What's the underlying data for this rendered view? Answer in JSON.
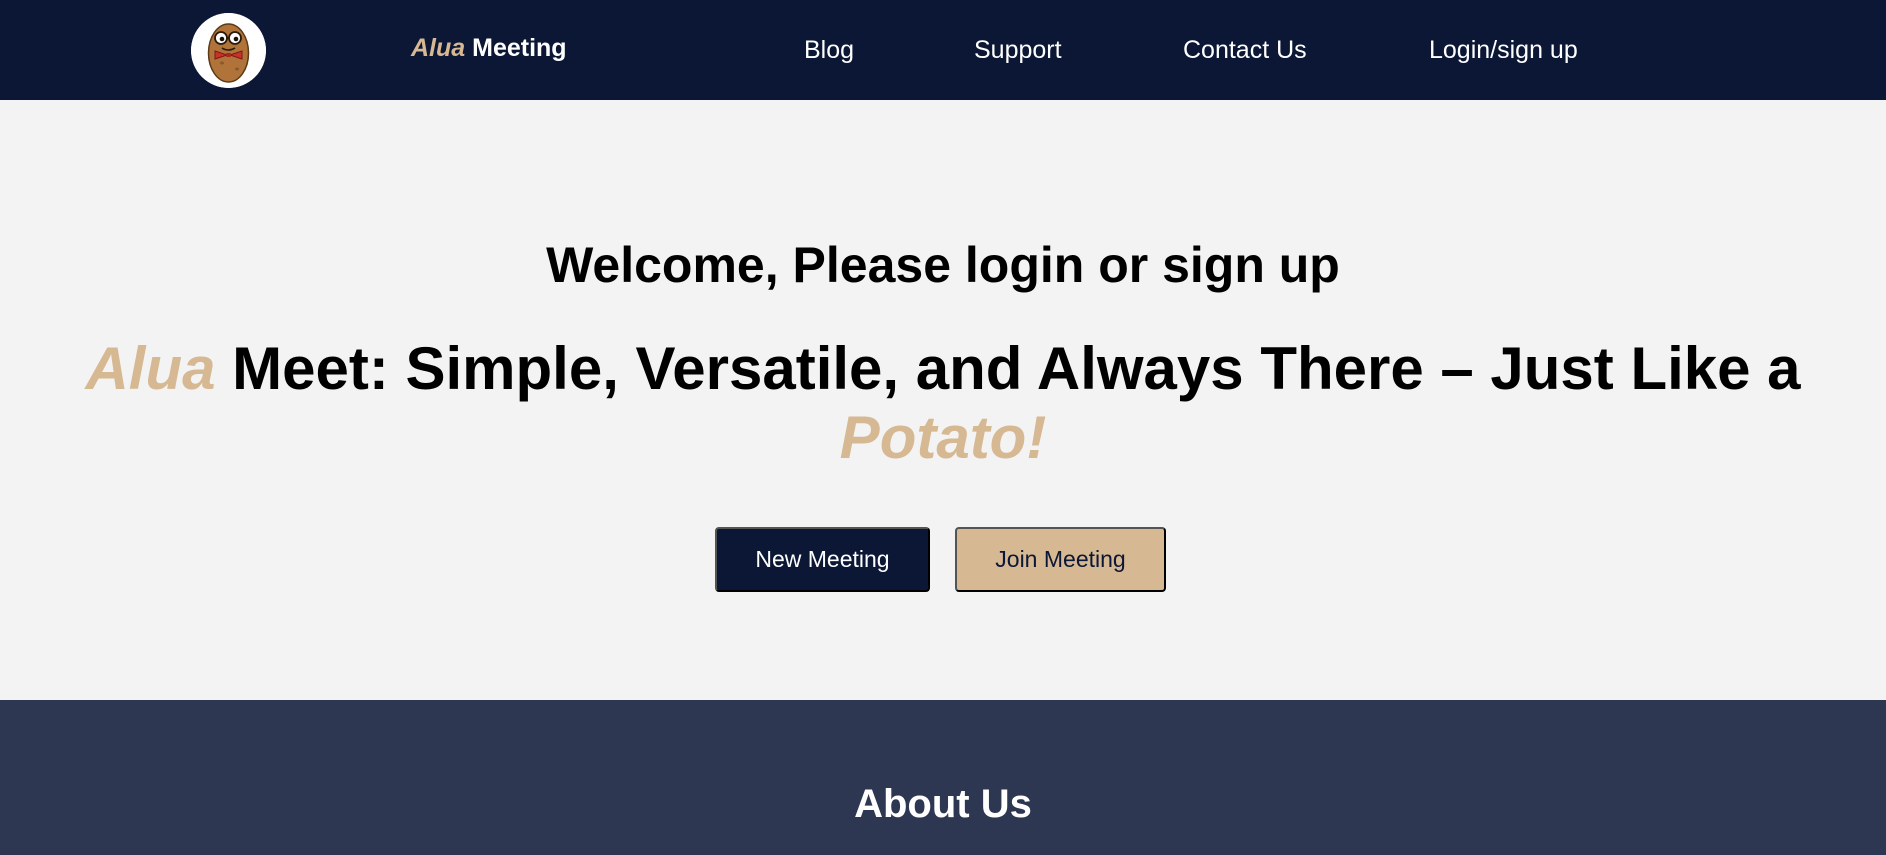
{
  "colors": {
    "navbar_bg": "#0b1735",
    "accent": "#d6b893",
    "hero_bg": "#f3f3f3",
    "about_bg": "#2d3752"
  },
  "header": {
    "logo_icon": "potato-mascot-icon",
    "brand_accent": "Alua",
    "brand_rest": " Meeting",
    "nav": {
      "blog": "Blog",
      "support": "Support",
      "contact": "Contact Us",
      "login": "Login/sign up"
    }
  },
  "hero": {
    "welcome": "Welcome, Please login or sign up",
    "tagline_accent_start": "Alua",
    "tagline_middle": " Meet: Simple, Versatile, and Always There – Just Like a ",
    "tagline_accent_end": "Potato!",
    "new_meeting_label": "New Meeting",
    "join_meeting_label": "Join Meeting"
  },
  "about": {
    "title": "About Us"
  }
}
